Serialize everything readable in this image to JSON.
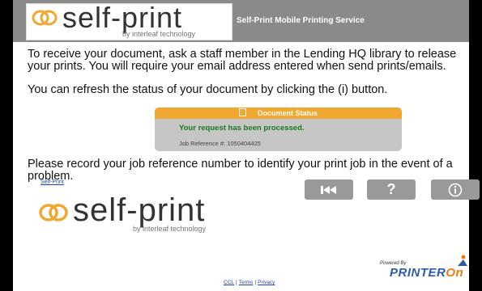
{
  "header": {
    "logo_text": "self-print",
    "logo_sub": "by interleaf technology",
    "title": "Self-Print Mobile Printing Service"
  },
  "content": {
    "paragraph1": "To receive your document, ask a staff member in the Lending HQ library to release your prints. You will require your email address entered when send prints/emails.",
    "paragraph2": "You can refresh the status of your document by clicking the (i) button.",
    "paragraph3": "Please record your job reference number to identify your print job in the event of a problem."
  },
  "status": {
    "title": "Document Status",
    "message": "Your request has been processed.",
    "reference": "Job Reference #: 1050404425",
    "colors": {
      "header": "#f0a830",
      "message": "#1a7a1a",
      "panel": "#c6c6c6"
    }
  },
  "link": {
    "self_print": "Self-Print"
  },
  "buttons": {
    "first_icon": "skip-to-first-icon",
    "help_label": "?",
    "info_icon": "info-icon"
  },
  "bottom_logo": {
    "text": "self-print",
    "sub": "by interleaf technology"
  },
  "powered": {
    "by": "Powered By",
    "brand_main": "PRINTER",
    "brand_on": "On"
  },
  "footer": {
    "ccl": "CCL",
    "terms": "Terms",
    "privacy": "Privacy",
    "separator": "|"
  }
}
